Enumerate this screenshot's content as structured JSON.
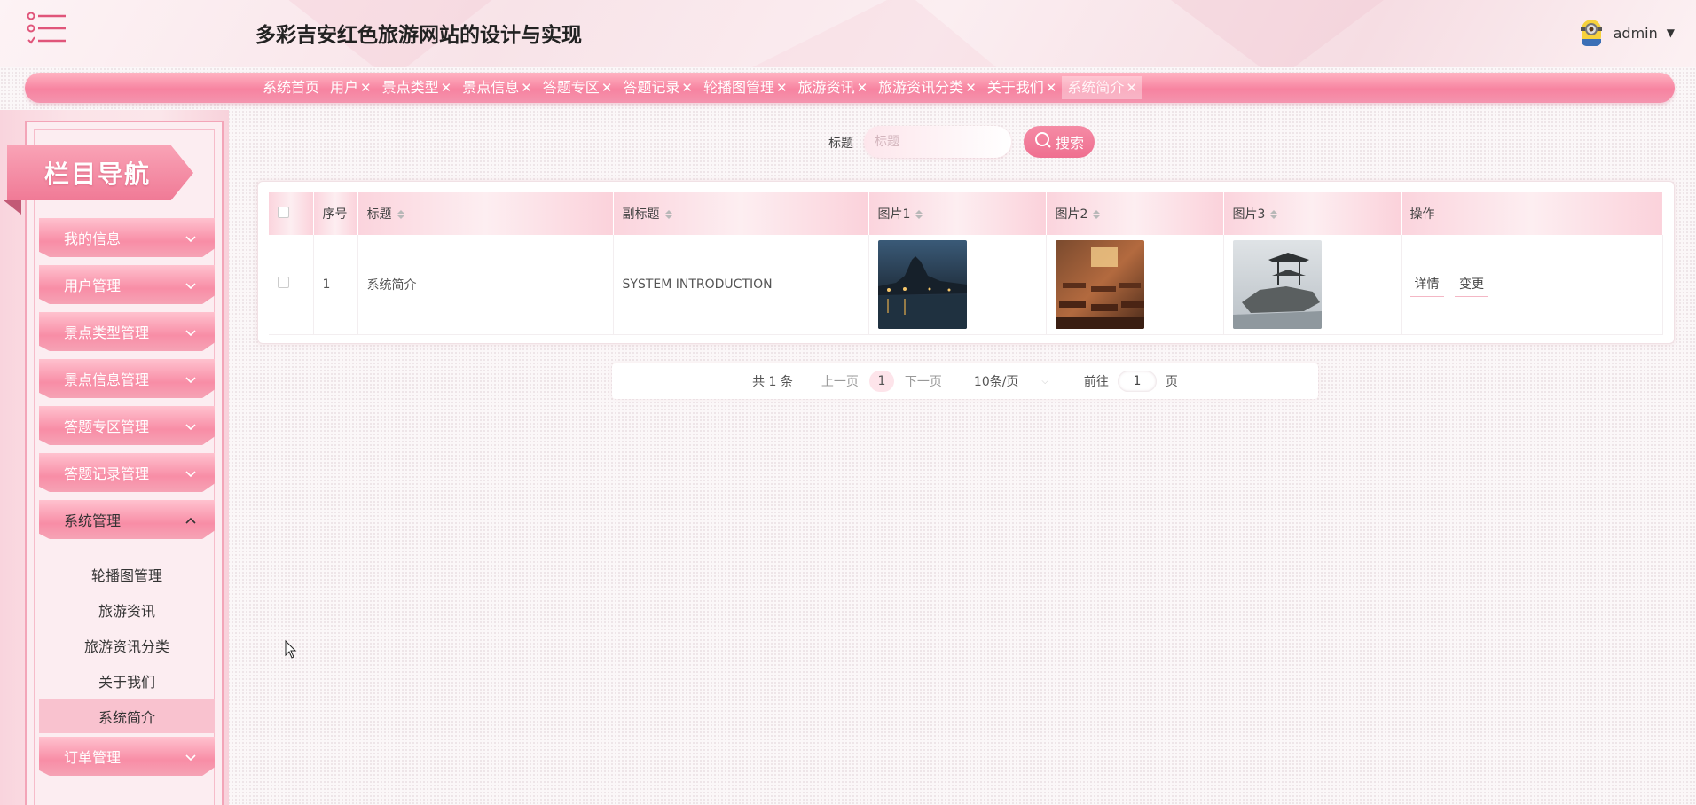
{
  "header": {
    "title": "多彩吉安红色旅游网站的设计与实现",
    "username": "admin",
    "menu_icon": "menu-list-icon",
    "avatar_icon": "minion-avatar-icon",
    "caret_icon": "caret-down-icon"
  },
  "tabs": [
    {
      "label": "系统首页",
      "closable": false
    },
    {
      "label": "用户",
      "closable": true
    },
    {
      "label": "景点类型",
      "closable": true
    },
    {
      "label": "景点信息",
      "closable": true
    },
    {
      "label": "答题专区",
      "closable": true
    },
    {
      "label": "答题记录",
      "closable": true
    },
    {
      "label": "轮播图管理",
      "closable": true
    },
    {
      "label": "旅游资讯",
      "closable": true
    },
    {
      "label": "旅游资讯分类",
      "closable": true
    },
    {
      "label": "关于我们",
      "closable": true
    },
    {
      "label": "系统简介",
      "closable": true,
      "active": true
    }
  ],
  "tab_close_glyph": "✕",
  "sidebar": {
    "title": "栏目导航",
    "items": [
      {
        "label": "我的信息"
      },
      {
        "label": "用户管理"
      },
      {
        "label": "景点类型管理"
      },
      {
        "label": "景点信息管理"
      },
      {
        "label": "答题专区管理"
      },
      {
        "label": "答题记录管理"
      },
      {
        "label": "系统管理",
        "expanded": true
      },
      {
        "label": "订单管理"
      }
    ],
    "sub_items": [
      {
        "label": "轮播图管理"
      },
      {
        "label": "旅游资讯"
      },
      {
        "label": "旅游资讯分类"
      },
      {
        "label": "关于我们"
      },
      {
        "label": "系统简介",
        "active": true
      }
    ]
  },
  "search": {
    "label": "标题",
    "placeholder": "标题",
    "value": "",
    "button_label": "搜索"
  },
  "table": {
    "columns": [
      "",
      "序号",
      "标题",
      "副标题",
      "图片1",
      "图片2",
      "图片3",
      "操作"
    ],
    "rows": [
      {
        "index": "1",
        "title": "系统简介",
        "subtitle": "SYSTEM INTRODUCTION",
        "images": [
          "night-lake-pavilion-image",
          "classroom-interior-image",
          "pavilion-on-rock-image"
        ],
        "actions": [
          "详情",
          "变更"
        ]
      }
    ]
  },
  "pagination": {
    "total_text": "共 1 条",
    "prev_label": "上一页",
    "current_page": "1",
    "next_label": "下一页",
    "page_size_label": "10条/页",
    "goto_label": "前往",
    "goto_value": "1",
    "page_unit": "页"
  },
  "colors": {
    "accent": "#f07a96",
    "accent_light": "#fbd4dd",
    "tab_bar": "#f783a0"
  }
}
